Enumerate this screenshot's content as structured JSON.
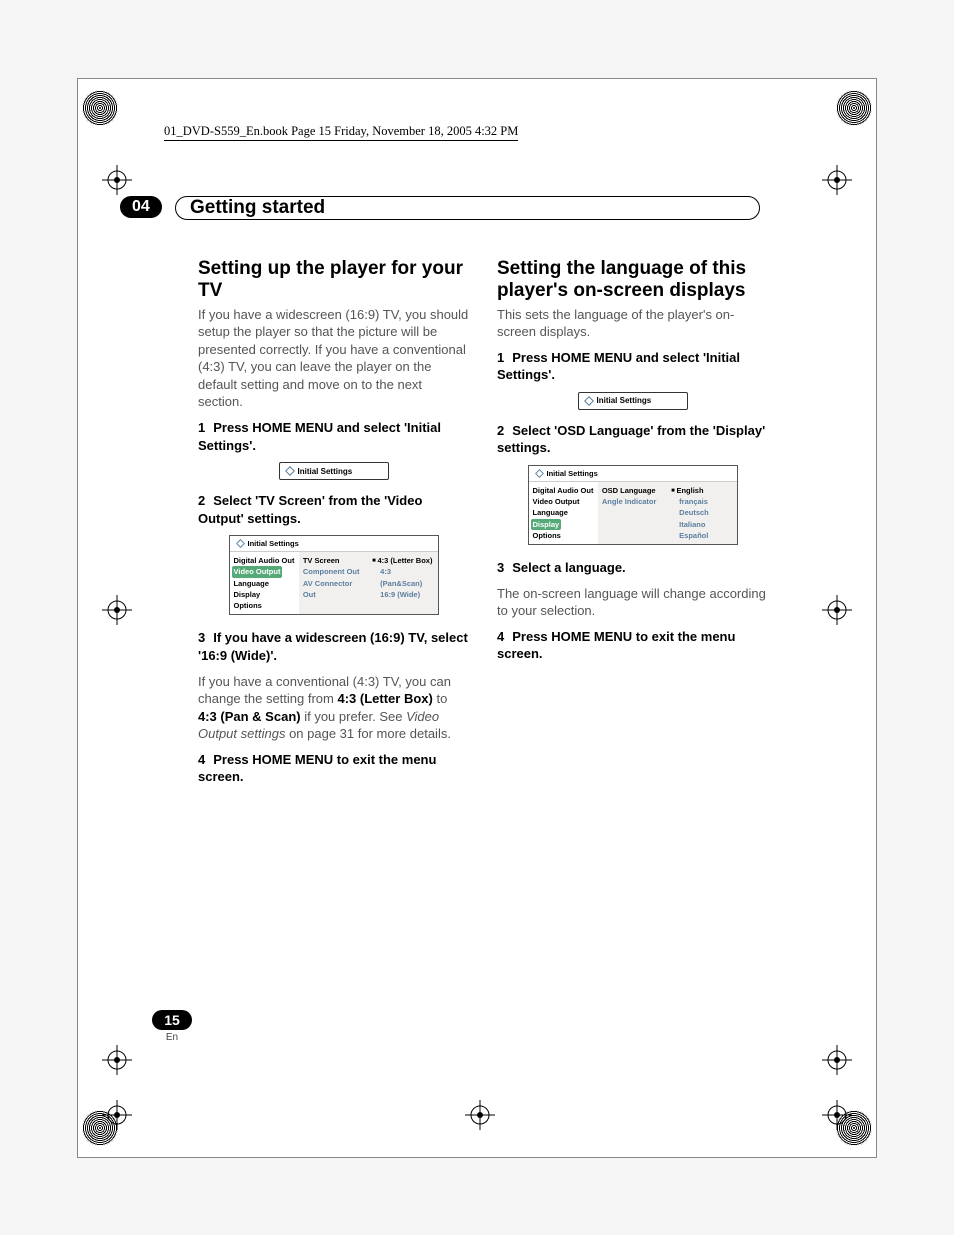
{
  "meta": {
    "book_line": "01_DVD-S559_En.book  Page 15  Friday, November 18, 2005  4:32 PM"
  },
  "chapter": {
    "num": "04",
    "title": "Getting started"
  },
  "page": {
    "num": "15",
    "lang": "En"
  },
  "left": {
    "h2": "Setting up the player for your TV",
    "intro": "If you have a widescreen (16:9) TV, you should setup the player so that the picture will be presented correctly. If you have a conventional (4:3) TV, you can leave the player on the default setting and move on to the next section.",
    "step1_num": "1",
    "step1": "Press HOME MENU and select 'Initial Settings'.",
    "osd_small": "Initial Settings",
    "step2_num": "2",
    "step2": "Select 'TV Screen' from the 'Video Output' settings.",
    "osd": {
      "head": "Initial Settings",
      "colA": [
        "Digital Audio Out",
        "Video Output",
        "Language",
        "Display",
        "Options"
      ],
      "colA_sel_index": 1,
      "colB": [
        "TV Screen",
        "Component Out",
        "AV Connector Out"
      ],
      "colB_sel_index": 0,
      "colC": [
        "4:3 (Letter Box)",
        "4:3 (Pan&Scan)",
        "16:9 (Wide)"
      ],
      "colC_sel_index": 0
    },
    "step3_num": "3",
    "step3": "If you have a widescreen (16:9) TV, select '16:9 (Wide)'.",
    "para3a": "If you have a conventional (4:3) TV, you can change the setting from ",
    "para3b": "4:3 (Letter Box)",
    "para3c": " to ",
    "para3d": "4:3 (Pan & Scan)",
    "para3e": " if you prefer. See ",
    "para3f": "Video Output settings",
    "para3g": " on page 31 for more details.",
    "step4_num": "4",
    "step4": "Press HOME MENU to exit the menu screen."
  },
  "right": {
    "h2": "Setting the language of this player's on-screen displays",
    "intro": "This sets the language of the player's on-screen displays.",
    "step1_num": "1",
    "step1": "Press HOME MENU and select 'Initial Settings'.",
    "osd_small": "Initial Settings",
    "step2_num": "2",
    "step2": "Select 'OSD Language' from the 'Display' settings.",
    "osd": {
      "head": "Initial Settings",
      "colA": [
        "Digital Audio Out",
        "Video Output",
        "Language",
        "Display",
        "Options"
      ],
      "colA_sel_index": 3,
      "colB": [
        "OSD Language",
        "Angle Indicator"
      ],
      "colB_sel_index": 0,
      "colC": [
        "English",
        "français",
        "Deutsch",
        "Italiano",
        "Español"
      ],
      "colC_sel_index": 0
    },
    "step3_num": "3",
    "step3": "Select a language.",
    "para3": "The on-screen language will change according to your selection.",
    "step4_num": "4",
    "step4": "Press HOME MENU to exit the menu screen."
  }
}
